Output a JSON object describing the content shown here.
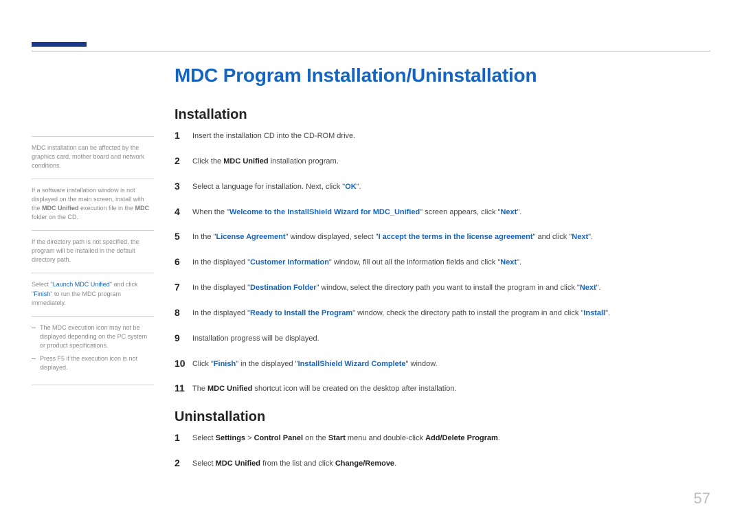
{
  "title": "MDC Program Installation/Uninstallation",
  "section_install": "Installation",
  "section_uninstall": "Uninstallation",
  "page_number": "57",
  "sidebar": {
    "note1": "MDC installation can be affected by the graphics card, mother board and network conditions.",
    "note2_pre": "If a software installation window is not displayed on the main screen, install with the ",
    "note2_b1": "MDC Unified",
    "note2_mid": " execution file in the ",
    "note2_b2": "MDC",
    "note2_post": " folder on the CD.",
    "note3": "If the directory path is not specified, the program will be installed in the default directory path.",
    "note4_pre": "Select \"",
    "note4_hl1": "Launch MDC Unified",
    "note4_mid1": "\" and click \"",
    "note4_hl2": "Finish",
    "note4_mid2": "\" to run the MDC program immediately.",
    "note5a": "The MDC execution icon may not be displayed depending on the PC system or product specifications.",
    "note5b": "Press F5 if the execution icon is not displayed."
  },
  "install": {
    "s1": "Insert the installation CD into the CD-ROM drive.",
    "s2_pre": "Click the ",
    "s2_b": "MDC Unified",
    "s2_post": " installation program.",
    "s3_pre": "Select a language for installation. Next, click \"",
    "s3_hl": "OK",
    "s3_post": "\".",
    "s4_pre": "When the \"",
    "s4_hl1": "Welcome to the InstallShield Wizard for MDC_Unified",
    "s4_mid": "\" screen appears, click \"",
    "s4_hl2": "Next",
    "s4_post": "\".",
    "s5_pre": "In the \"",
    "s5_hl1": "License Agreement",
    "s5_mid1": "\" window displayed, select \"",
    "s5_hl2": "I accept the terms in the license agreement",
    "s5_mid2": "\" and click \"",
    "s5_hl3": "Next",
    "s5_post": "\".",
    "s6_pre": "In the displayed \"",
    "s6_hl1": "Customer Information",
    "s6_mid": "\" window, fill out all the information fields and click \"",
    "s6_hl2": "Next",
    "s6_post": "\".",
    "s7_pre": "In the displayed \"",
    "s7_hl1": "Destination Folder",
    "s7_mid": "\" window, select the directory path you want to install the program in and click \"",
    "s7_hl2": "Next",
    "s7_post": "\".",
    "s8_pre": "In the displayed \"",
    "s8_hl1": "Ready to Install the Program",
    "s8_mid": "\" window, check the directory path to install the program in and click \"",
    "s8_hl2": "Install",
    "s8_post": "\".",
    "s9": "Installation progress will be displayed.",
    "s10_pre": "Click \"",
    "s10_hl1": "Finish",
    "s10_mid": "\" in the displayed \"",
    "s10_hl2": "InstallShield Wizard Complete",
    "s10_post": "\" window.",
    "s11_pre": "The ",
    "s11_b": "MDC Unified",
    "s11_post": " shortcut icon will be created on the desktop after installation."
  },
  "uninstall": {
    "s1_pre": "Select ",
    "s1_b1": "Settings",
    "s1_gt": " > ",
    "s1_b2": "Control Panel",
    "s1_mid1": " on the ",
    "s1_b3": "Start",
    "s1_mid2": " menu and double-click ",
    "s1_b4": "Add/Delete Program",
    "s1_post": ".",
    "s2_pre": "Select ",
    "s2_b1": "MDC Unified",
    "s2_mid": " from the list and click ",
    "s2_b2": "Change/Remove",
    "s2_post": "."
  }
}
